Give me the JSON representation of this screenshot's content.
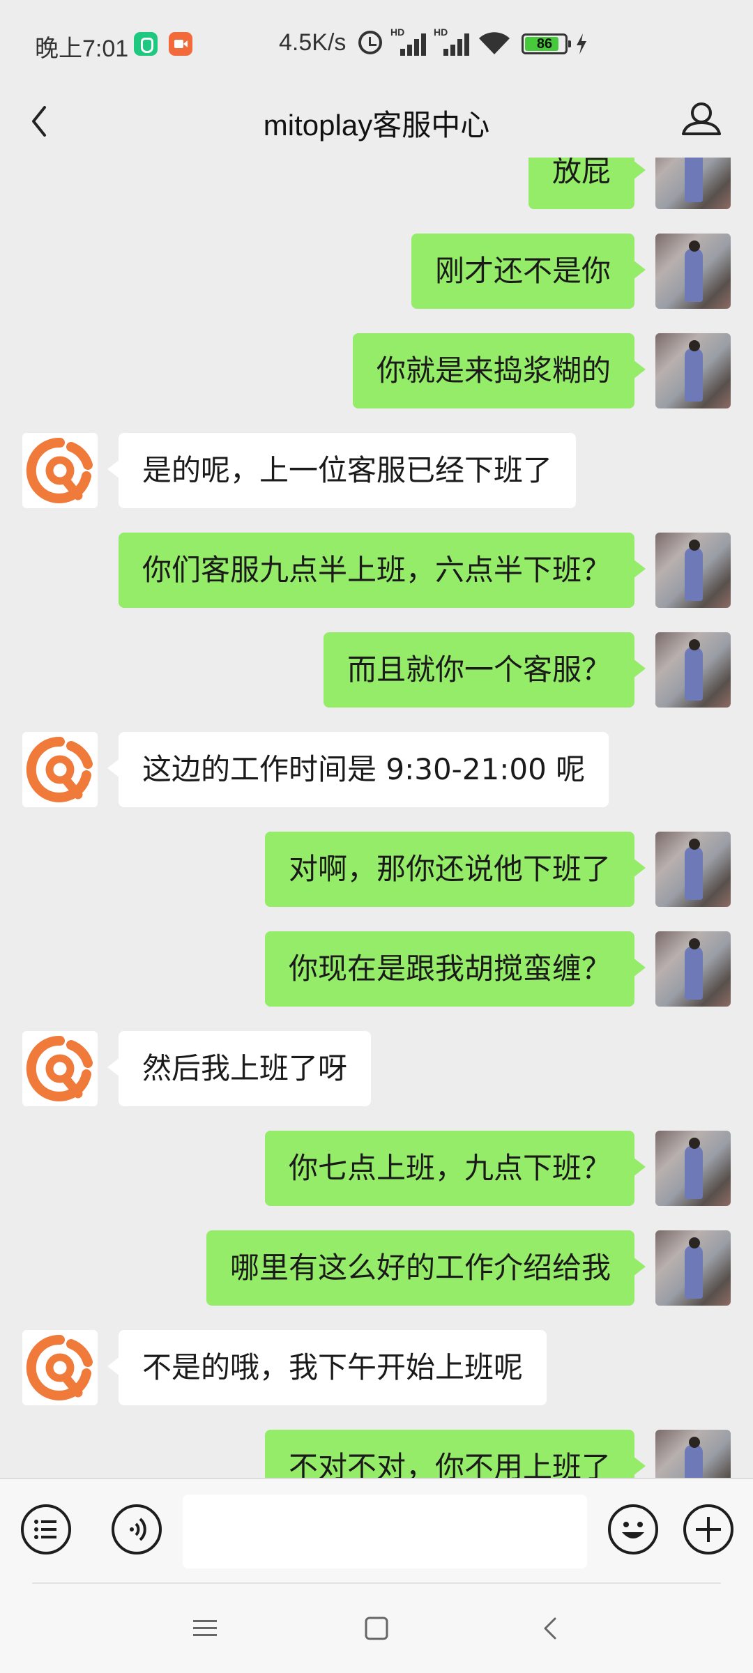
{
  "status_bar": {
    "time": "晚上7:01",
    "network_speed": "4.5K/s",
    "signal_1_label": "HD",
    "signal_2_label": "HD",
    "battery_level": 86,
    "battery_text": "86",
    "icons": [
      "app-green-icon",
      "screen-record-icon",
      "alarm-icon",
      "signal-icon",
      "signal-icon",
      "wifi-icon",
      "battery-icon",
      "charging-icon"
    ]
  },
  "header": {
    "title": "mitoplay客服中心",
    "back_icon": "chevron-left-icon",
    "profile_icon": "person-icon"
  },
  "messages": [
    {
      "sender": "me",
      "text": "放屁"
    },
    {
      "sender": "me",
      "text": "刚才还不是你"
    },
    {
      "sender": "me",
      "text": "你就是来捣浆糊的"
    },
    {
      "sender": "agent",
      "text": "是的呢，上一位客服已经下班了"
    },
    {
      "sender": "me",
      "text": "你们客服九点半上班，六点半下班？"
    },
    {
      "sender": "me",
      "text": "而且就你一个客服？"
    },
    {
      "sender": "agent",
      "text": "这边的工作时间是 9:30-21:00 呢"
    },
    {
      "sender": "me",
      "text": "对啊，那你还说他下班了"
    },
    {
      "sender": "me",
      "text": "你现在是跟我胡搅蛮缠？"
    },
    {
      "sender": "agent",
      "text": "然后我上班了呀"
    },
    {
      "sender": "me",
      "text": "你七点上班，九点下班？"
    },
    {
      "sender": "me",
      "text": "哪里有这么好的工作介绍给我"
    },
    {
      "sender": "agent",
      "text": "不是的哦，我下午开始上班呢"
    },
    {
      "sender": "me",
      "text": "不对不对，你不用上班了"
    }
  ],
  "input_bar": {
    "menu_icon": "list-menu-icon",
    "voice_icon": "voice-icon",
    "input_value": "",
    "emoji_icon": "emoji-icon",
    "add_icon": "plus-icon"
  },
  "nav_bar": {
    "icons": [
      "nav-menu-icon",
      "nav-home-icon",
      "nav-back-icon"
    ]
  },
  "colors": {
    "background": "#ededed",
    "my_bubble": "#95ec69",
    "agent_bubble": "#ffffff",
    "agent_logo": "#f07a3a",
    "battery_fill": "#46c93a"
  }
}
